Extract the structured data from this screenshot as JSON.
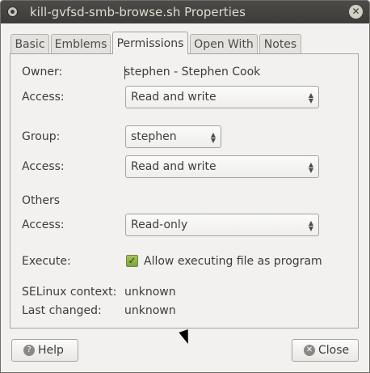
{
  "window": {
    "title": "kill-gvfsd-smb-browse.sh Properties"
  },
  "tabs": [
    {
      "label": "Basic"
    },
    {
      "label": "Emblems"
    },
    {
      "label": "Permissions"
    },
    {
      "label": "Open With"
    },
    {
      "label": "Notes"
    }
  ],
  "active_tab": "Permissions",
  "permissions": {
    "owner_label": "Owner:",
    "owner_value": "stephen - Stephen Cook",
    "owner_access_label": "Access:",
    "owner_access_value": "Read and write",
    "group_label": "Group:",
    "group_value": "stephen",
    "group_access_label": "Access:",
    "group_access_value": "Read and write",
    "others_label": "Others",
    "others_access_label": "Access:",
    "others_access_value": "Read-only",
    "execute_label": "Execute:",
    "execute_checkbox_label": "Allow executing file as program",
    "execute_checked": true,
    "selinux_label": "SELinux context:",
    "selinux_value": "unknown",
    "last_changed_label": "Last changed:",
    "last_changed_value": "unknown"
  },
  "buttons": {
    "help": "Help",
    "close": "Close"
  },
  "icons": {
    "window_icon": "window-menu-icon",
    "close_icon": "close-icon",
    "help_icon": "help-icon",
    "close_button_icon": "close-x-icon",
    "checkbox": "checkmark-icon"
  },
  "colors": {
    "checkbox_green": "#7fa33a",
    "titlebar": "#3c3b37"
  }
}
